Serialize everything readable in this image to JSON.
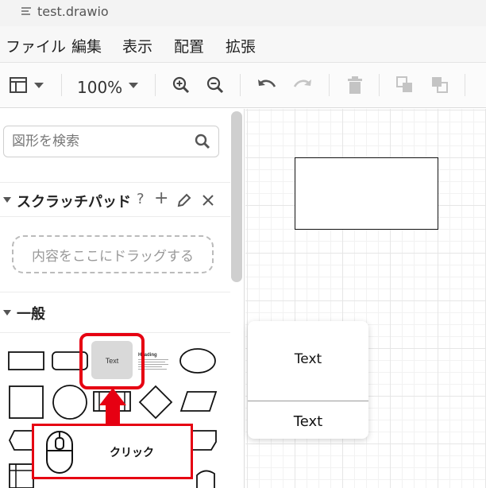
{
  "window": {
    "title": "test.drawio"
  },
  "menu": [
    "ファイル",
    "編集",
    "表示",
    "配置",
    "拡張"
  ],
  "toolbar": {
    "zoom": "100%"
  },
  "sidebar": {
    "search_placeholder": "図形を検索",
    "scratchpad": {
      "title": "スクラッチパッド",
      "help": "?",
      "add": "+",
      "drop_hint": "内容をここにドラッグする"
    },
    "general": {
      "title": "一般",
      "text_shape_label": "Text",
      "heading_label": "Heading"
    }
  },
  "preview": {
    "large_text": "Text",
    "small_text": "Text"
  },
  "annotation": {
    "click_label": "クリック",
    "highlight_color": "#e60012"
  }
}
